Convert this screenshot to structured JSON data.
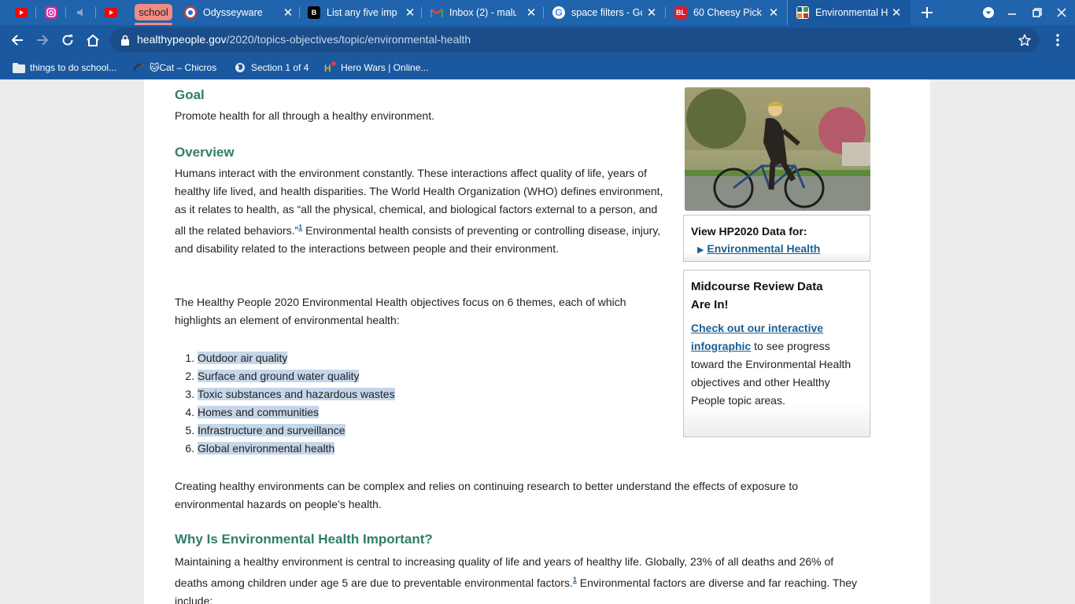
{
  "browser": {
    "group_label": "school",
    "tabs": [
      {
        "title": "Odysseyware"
      },
      {
        "title": "List any five impo"
      },
      {
        "title": "Inbox (2) - malus"
      },
      {
        "title": "space filters - Goo"
      },
      {
        "title": "60 Cheesy Pick U"
      },
      {
        "title": "Environmental H"
      }
    ],
    "url_host": "healthypeople.gov",
    "url_path": "/2020/topics-objectives/topic/environmental-health",
    "bookmarks": [
      {
        "label": "things to do school..."
      },
      {
        "label": "🐱Cat – Chicros"
      },
      {
        "label": "Section 1 of 4"
      },
      {
        "label": "Hero Wars | Online..."
      }
    ]
  },
  "article": {
    "goal_heading": "Goal",
    "goal_text": "Promote health for all through a healthy environment.",
    "overview_heading": "Overview",
    "overview_p1a": "Humans interact with the environment constantly. These interactions affect quality of life, years of healthy life lived, and health disparities. The World Health Organization (WHO) defines environment, as it relates to health, as “all the physical, chemical, and biological factors external to a person, and all the related behaviors.”",
    "footnote": "1",
    "overview_p1b": " Environmental health consists of preventing or controlling disease, injury, and disability related to the interactions between people and their environment.",
    "overview_p2": "The Healthy People 2020 Environmental Health objectives focus on 6 themes, each of which highlights an element of environmental health:",
    "themes": [
      "Outdoor air quality",
      "Surface and ground water quality",
      "Toxic substances and hazardous wastes",
      "Homes and communities",
      "Infrastructure and surveillance",
      "Global environmental health"
    ],
    "overview_p3": "Creating healthy environments can be complex and relies on continuing research to better understand the effects of exposure to environmental hazards on people’s health.",
    "why_heading": "Why Is Environmental Health Important?",
    "why_p1a": "Maintaining a healthy environment is central to increasing quality of life and years of healthy life. Globally, 23% of all deaths and 26% of deaths among children under age 5 are due to preventable environmental factors.",
    "why_p1b": " Environmental factors are diverse and far reaching. They include:"
  },
  "sidebar": {
    "data_box_title": "View HP2020 Data for:",
    "data_box_link": "Environmental Health",
    "review_title_line1": "Midcourse Review Data",
    "review_title_line2": "Are In!",
    "review_link": "Check out our interactive infographic",
    "review_text": " to see progress toward the Environmental Health objectives and other Healthy People topic areas."
  }
}
